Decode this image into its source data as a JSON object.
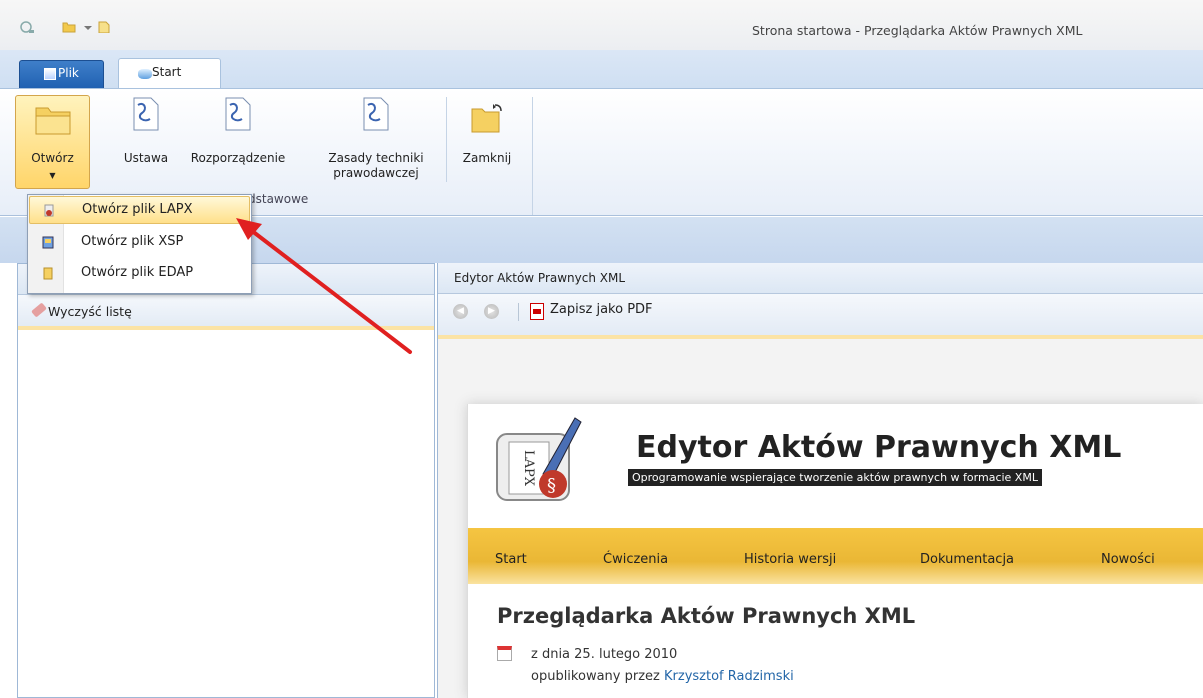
{
  "window": {
    "title": "Strona startowa - Przeglądarka Aktów Prawnych XML"
  },
  "tabs": [
    {
      "label": "Plik"
    },
    {
      "label": "Start"
    }
  ],
  "ribbon": {
    "open_label": "Otwórz",
    "ustawa_label": "Ustawa",
    "rozporzadzenie_label": "Rozporządzenie",
    "zasady_label_1": "Zasady techniki",
    "zasady_label_2": "prawodawczej",
    "zamknij_label": "Zamknij",
    "group_label": "dstawowe"
  },
  "dropdown": {
    "items": [
      {
        "label": "Otwórz plik LAPX"
      },
      {
        "label": "Otwórz plik XSP"
      },
      {
        "label": "Otwórz plik EDAP"
      }
    ]
  },
  "left_panel": {
    "clear_label": "Wyczyść listę"
  },
  "right_panel": {
    "title": "Edytor Aktów Prawnych XML",
    "save_pdf_label": "Zapisz jako PDF"
  },
  "webpage": {
    "title": "Edytor Aktów Prawnych XML",
    "subtitle": "Oprogramowanie wspierające tworzenie aktów prawnych w formacie XML",
    "nav": [
      "Start",
      "Ćwiczenia",
      "Historia wersji",
      "Dokumentacja",
      "Nowości"
    ],
    "article_title": "Przeglądarka Aktów Prawnych XML",
    "date": "z dnia 25. lutego 2010",
    "author_prefix": "opublikowany przez",
    "author": "Krzysztof Radzimski",
    "logo_text": "LAPX"
  },
  "colors": {
    "ribbon_accent": "#ffd56a",
    "arrow": "#e02020",
    "nav_bar": "#f5c542",
    "link": "#2366a8"
  },
  "icons": [
    "app-icon",
    "open-folder-icon",
    "new-file-icon",
    "document-icon",
    "close-folder-icon",
    "eraser-icon",
    "back-icon",
    "forward-icon",
    "pdf-icon",
    "calendar-icon",
    "lapx-file-icon",
    "xsp-file-icon",
    "edap-file-icon"
  ]
}
